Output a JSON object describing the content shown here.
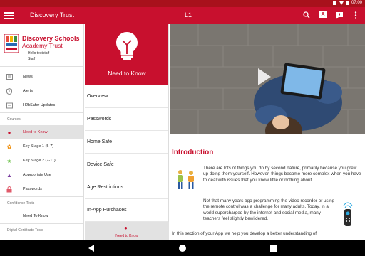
{
  "status_bar": {
    "time": "07:00"
  },
  "app_bar": {
    "title": "Discovery Trust",
    "subtitle": "L1",
    "actions": [
      {
        "name": "search-icon"
      },
      {
        "name": "translate-icon",
        "label": "A"
      },
      {
        "name": "chat-icon"
      },
      {
        "name": "more-icon"
      }
    ]
  },
  "sidebar": {
    "school_name_line1": "Discovery Schools",
    "school_name_line2": "Academy Trust",
    "user_greeting": "Hello teststaff",
    "user_role": "Staff",
    "items": [
      {
        "label": "News",
        "icon": "news-icon"
      },
      {
        "label": "Alerts",
        "icon": "alert-shield-icon"
      },
      {
        "label": "H2bSafer Updates",
        "icon": "updates-icon"
      }
    ],
    "courses_label": "Courses",
    "courses": [
      {
        "label": "Need to Know",
        "icon": "bulb-icon",
        "active": true
      },
      {
        "label": "Key Stage 1 (5-7)",
        "icon": "paw-icon"
      },
      {
        "label": "Key Stage 2 (7-11)",
        "icon": "star-icon"
      },
      {
        "label": "Appropriate Use",
        "icon": "thumbs-up-icon"
      },
      {
        "label": "Passwords",
        "icon": "lock-icon"
      }
    ],
    "confidence_label": "Confidence Tests",
    "confidence_items": [
      {
        "label": "Need To Know"
      }
    ],
    "certificate_label": "Digital Certificate Tests"
  },
  "lesson": {
    "title": "Need to Know",
    "items": [
      "Overview",
      "Passwords",
      "Home Safe",
      "Device Safe",
      "Age Restrictions",
      "In-App Purchases"
    ],
    "footer_label": "Need to Know"
  },
  "content": {
    "heading": "Introduction",
    "paragraph1": "There are lots of things you do by second nature, primarily because you grew up doing them yourself. However, things become more complex when you have to deal with issues that you know little or nothing about.",
    "paragraph2": "Not that many years ago programming the video recorder or using the remote control was a challenge for many adults. Today, in a world supercharged by the internet and social media, many teachers feel slightly bewildered.",
    "paragraph3": "In this section of your App we help you develop a better understanding of"
  },
  "colors": {
    "brand": "#c8102e",
    "brand_dark": "#a8111c",
    "active_bg": "#e2e2e2"
  }
}
